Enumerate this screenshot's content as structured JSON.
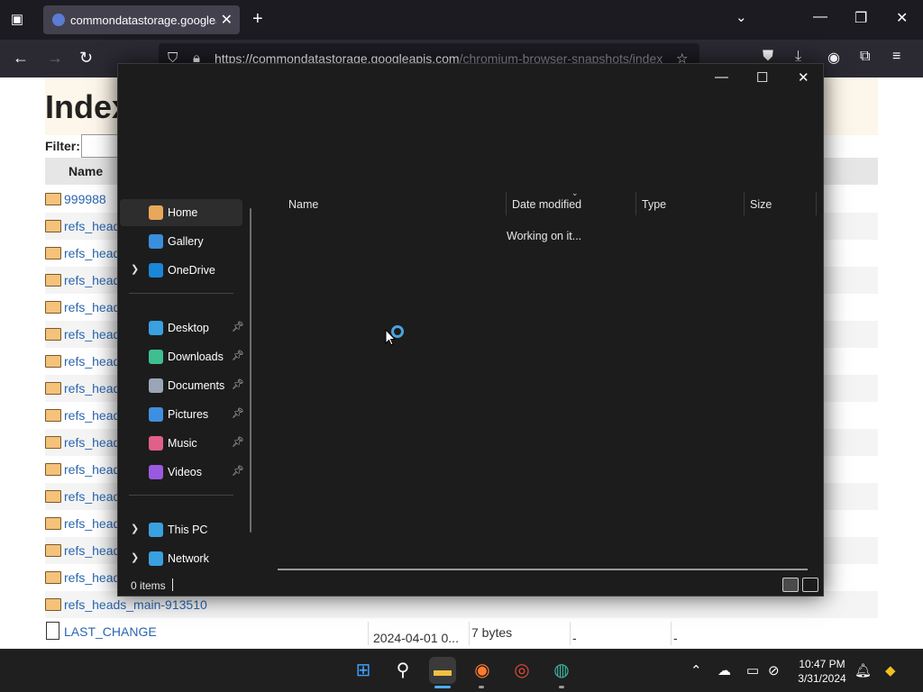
{
  "browser": {
    "tab_title": "commondatastorage.googleapis.com",
    "url_host": "https://commondatastorage.googleapis.com",
    "url_path": "/chromium-browser-snapshots/index",
    "tab_close": "✕",
    "new_tab": "+"
  },
  "webpage": {
    "title": "Index",
    "filter_label": "Filter:",
    "name_header": "Name",
    "rows": [
      {
        "name": "999988",
        "kind": "folder"
      },
      {
        "name": "refs_heads",
        "kind": "folder"
      },
      {
        "name": "refs_heads",
        "kind": "folder"
      },
      {
        "name": "refs_heads",
        "kind": "folder"
      },
      {
        "name": "refs_heads",
        "kind": "folder"
      },
      {
        "name": "refs_heads",
        "kind": "folder"
      },
      {
        "name": "refs_heads",
        "kind": "folder"
      },
      {
        "name": "refs_heads",
        "kind": "folder"
      },
      {
        "name": "refs_heads",
        "kind": "folder"
      },
      {
        "name": "refs_heads",
        "kind": "folder"
      },
      {
        "name": "refs_heads",
        "kind": "folder"
      },
      {
        "name": "refs_heads",
        "kind": "folder"
      },
      {
        "name": "refs_heads",
        "kind": "folder"
      },
      {
        "name": "refs_heads",
        "kind": "folder"
      },
      {
        "name": "refs_heads",
        "kind": "folder"
      },
      {
        "name": "refs_heads_main-913510",
        "kind": "folder"
      }
    ],
    "last_change": {
      "name": "LAST_CHANGE",
      "date": "2024-04-01 0...",
      "size": "7 bytes",
      "c3": "-",
      "c4": "-"
    }
  },
  "explorer": {
    "nav_items": [
      {
        "label": "Home",
        "icon": "home-icon",
        "color": "#e8a85a"
      },
      {
        "label": "Gallery",
        "icon": "gallery-icon",
        "color": "#3a8fdc"
      },
      {
        "label": "OneDrive",
        "icon": "onedrive-icon",
        "color": "#1a86d8"
      }
    ],
    "quick_access": [
      {
        "label": "Desktop",
        "icon": "desktop-icon",
        "color": "#3aa0e0"
      },
      {
        "label": "Downloads",
        "icon": "downloads-icon",
        "color": "#3fbf8f"
      },
      {
        "label": "Documents",
        "icon": "documents-icon",
        "color": "#9aa6b8"
      },
      {
        "label": "Pictures",
        "icon": "pictures-icon",
        "color": "#3f8fe0"
      },
      {
        "label": "Music",
        "icon": "music-icon",
        "color": "#e0608a"
      },
      {
        "label": "Videos",
        "icon": "videos-icon",
        "color": "#9a5ae0"
      }
    ],
    "locations": [
      {
        "label": "This PC",
        "icon": "this-pc-icon",
        "color": "#3aa0e0"
      },
      {
        "label": "Network",
        "icon": "network-icon",
        "color": "#3aa0e0"
      }
    ],
    "columns": {
      "name": "Name",
      "date_modified": "Date modified",
      "type": "Type",
      "size": "Size"
    },
    "status_message": "Working on it...",
    "item_count": "0 items"
  },
  "taskbar": {
    "time": "10:47 PM",
    "date": "3/31/2024"
  }
}
